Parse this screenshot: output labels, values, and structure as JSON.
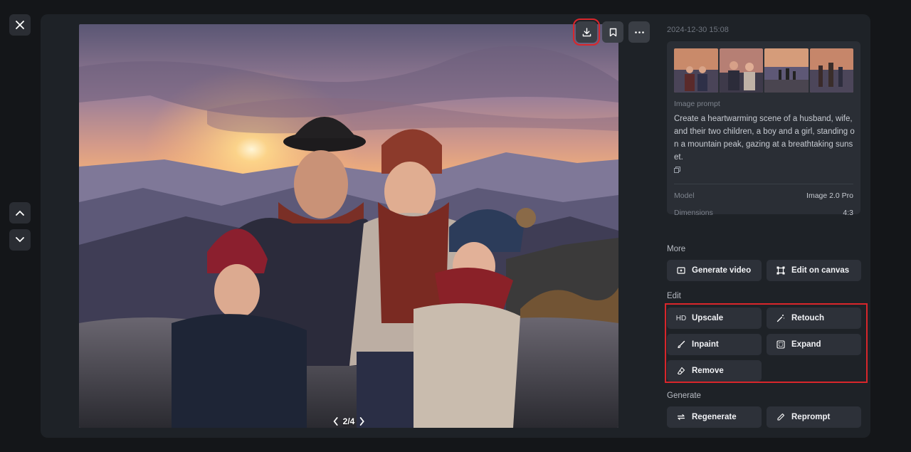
{
  "viewer": {
    "pager": {
      "current": "2/4"
    },
    "thumbnails": [
      "thumb-1",
      "thumb-2",
      "thumb-3",
      "thumb-4"
    ]
  },
  "sidebar": {
    "timestamp": "2024-12-30 15:08",
    "prompt_label": "Image prompt",
    "prompt_text": "Create a heartwarming scene of a husband, wife, and their two children, a boy and a girl, standing on a mountain peak, gazing at a breathtaking sunset.",
    "meta": [
      {
        "key": "Model",
        "value": "Image 2.0 Pro"
      },
      {
        "key": "Dimensions",
        "value": "4:3"
      }
    ],
    "more": {
      "title": "More",
      "buttons": [
        {
          "label": "Generate video",
          "icon": "video-plus-icon"
        },
        {
          "label": "Edit on canvas",
          "icon": "canvas-icon"
        }
      ]
    },
    "edit": {
      "title": "Edit",
      "buttons": [
        {
          "label": "Upscale",
          "icon": "HD"
        },
        {
          "label": "Retouch",
          "icon": "magic-wand-icon"
        },
        {
          "label": "Inpaint",
          "icon": "brush-icon"
        },
        {
          "label": "Expand",
          "icon": "expand-icon"
        },
        {
          "label": "Remove",
          "icon": "eraser-icon"
        }
      ]
    },
    "generate": {
      "title": "Generate",
      "buttons": [
        {
          "label": "Regenerate",
          "icon": "regenerate-icon"
        },
        {
          "label": "Reprompt",
          "icon": "pencil-icon"
        }
      ]
    }
  },
  "colors": {
    "accent_highlight": "#d9262b",
    "panel": "#1e2227",
    "button": "#2d3139"
  }
}
